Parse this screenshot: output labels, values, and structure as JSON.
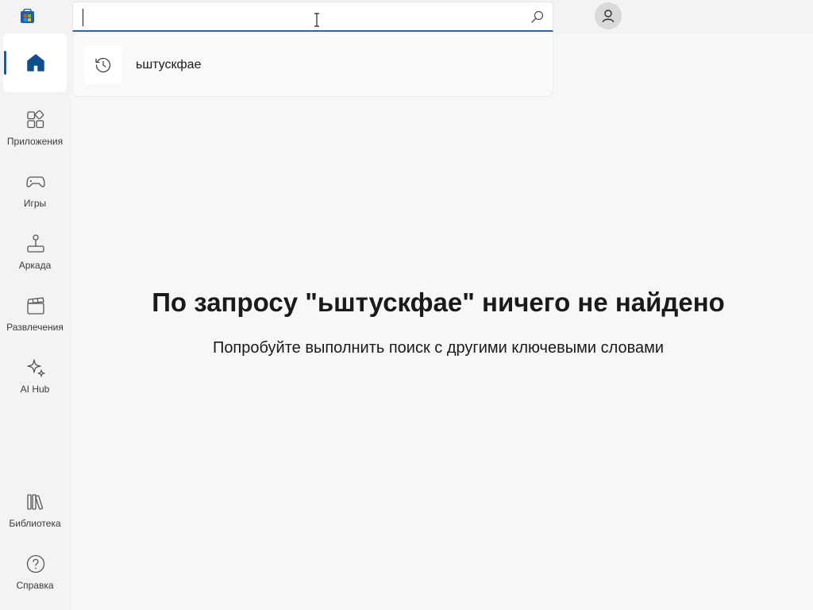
{
  "search": {
    "value": "",
    "icon": "search-icon"
  },
  "suggestions": [
    {
      "icon": "history-icon",
      "text": "ьштускфае"
    }
  ],
  "sidebar": {
    "items": [
      {
        "label": "",
        "icon": "home-icon",
        "active": true
      },
      {
        "label": "Приложения",
        "icon": "apps-icon"
      },
      {
        "label": "Игры",
        "icon": "gamepad-icon"
      },
      {
        "label": "Аркада",
        "icon": "joystick-icon"
      },
      {
        "label": "Развлечения",
        "icon": "clapperboard-icon"
      },
      {
        "label": "AI Hub",
        "icon": "sparkle-icon"
      },
      {
        "label": "Библиотека",
        "icon": "library-icon"
      },
      {
        "label": "Справка",
        "icon": "help-icon"
      }
    ]
  },
  "main": {
    "empty_title": "По запросу \"ьштускфае\" ничего не найдено",
    "empty_subtitle": "Попробуйте выполнить поиск с другими ключевыми словами"
  },
  "colors": {
    "accent": "#005fb8",
    "background": "#f7f7f7",
    "sidebar": "#f3f3f3"
  }
}
